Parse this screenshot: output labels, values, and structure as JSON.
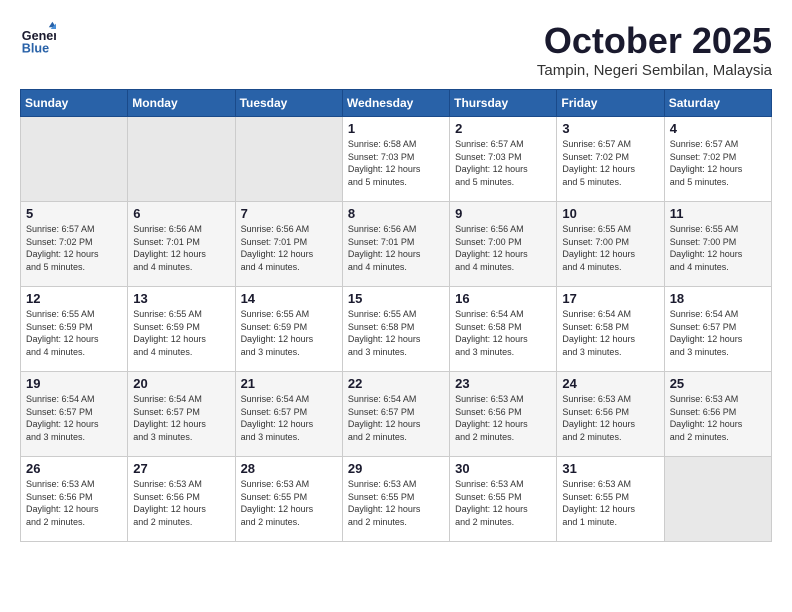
{
  "header": {
    "logo_line1": "General",
    "logo_line2": "Blue",
    "month_title": "October 2025",
    "subtitle": "Tampin, Negeri Sembilan, Malaysia"
  },
  "days_of_week": [
    "Sunday",
    "Monday",
    "Tuesday",
    "Wednesday",
    "Thursday",
    "Friday",
    "Saturday"
  ],
  "weeks": [
    [
      {
        "day": "",
        "info": ""
      },
      {
        "day": "",
        "info": ""
      },
      {
        "day": "",
        "info": ""
      },
      {
        "day": "1",
        "info": "Sunrise: 6:58 AM\nSunset: 7:03 PM\nDaylight: 12 hours\nand 5 minutes."
      },
      {
        "day": "2",
        "info": "Sunrise: 6:57 AM\nSunset: 7:03 PM\nDaylight: 12 hours\nand 5 minutes."
      },
      {
        "day": "3",
        "info": "Sunrise: 6:57 AM\nSunset: 7:02 PM\nDaylight: 12 hours\nand 5 minutes."
      },
      {
        "day": "4",
        "info": "Sunrise: 6:57 AM\nSunset: 7:02 PM\nDaylight: 12 hours\nand 5 minutes."
      }
    ],
    [
      {
        "day": "5",
        "info": "Sunrise: 6:57 AM\nSunset: 7:02 PM\nDaylight: 12 hours\nand 5 minutes."
      },
      {
        "day": "6",
        "info": "Sunrise: 6:56 AM\nSunset: 7:01 PM\nDaylight: 12 hours\nand 4 minutes."
      },
      {
        "day": "7",
        "info": "Sunrise: 6:56 AM\nSunset: 7:01 PM\nDaylight: 12 hours\nand 4 minutes."
      },
      {
        "day": "8",
        "info": "Sunrise: 6:56 AM\nSunset: 7:01 PM\nDaylight: 12 hours\nand 4 minutes."
      },
      {
        "day": "9",
        "info": "Sunrise: 6:56 AM\nSunset: 7:00 PM\nDaylight: 12 hours\nand 4 minutes."
      },
      {
        "day": "10",
        "info": "Sunrise: 6:55 AM\nSunset: 7:00 PM\nDaylight: 12 hours\nand 4 minutes."
      },
      {
        "day": "11",
        "info": "Sunrise: 6:55 AM\nSunset: 7:00 PM\nDaylight: 12 hours\nand 4 minutes."
      }
    ],
    [
      {
        "day": "12",
        "info": "Sunrise: 6:55 AM\nSunset: 6:59 PM\nDaylight: 12 hours\nand 4 minutes."
      },
      {
        "day": "13",
        "info": "Sunrise: 6:55 AM\nSunset: 6:59 PM\nDaylight: 12 hours\nand 4 minutes."
      },
      {
        "day": "14",
        "info": "Sunrise: 6:55 AM\nSunset: 6:59 PM\nDaylight: 12 hours\nand 3 minutes."
      },
      {
        "day": "15",
        "info": "Sunrise: 6:55 AM\nSunset: 6:58 PM\nDaylight: 12 hours\nand 3 minutes."
      },
      {
        "day": "16",
        "info": "Sunrise: 6:54 AM\nSunset: 6:58 PM\nDaylight: 12 hours\nand 3 minutes."
      },
      {
        "day": "17",
        "info": "Sunrise: 6:54 AM\nSunset: 6:58 PM\nDaylight: 12 hours\nand 3 minutes."
      },
      {
        "day": "18",
        "info": "Sunrise: 6:54 AM\nSunset: 6:57 PM\nDaylight: 12 hours\nand 3 minutes."
      }
    ],
    [
      {
        "day": "19",
        "info": "Sunrise: 6:54 AM\nSunset: 6:57 PM\nDaylight: 12 hours\nand 3 minutes."
      },
      {
        "day": "20",
        "info": "Sunrise: 6:54 AM\nSunset: 6:57 PM\nDaylight: 12 hours\nand 3 minutes."
      },
      {
        "day": "21",
        "info": "Sunrise: 6:54 AM\nSunset: 6:57 PM\nDaylight: 12 hours\nand 3 minutes."
      },
      {
        "day": "22",
        "info": "Sunrise: 6:54 AM\nSunset: 6:57 PM\nDaylight: 12 hours\nand 2 minutes."
      },
      {
        "day": "23",
        "info": "Sunrise: 6:53 AM\nSunset: 6:56 PM\nDaylight: 12 hours\nand 2 minutes."
      },
      {
        "day": "24",
        "info": "Sunrise: 6:53 AM\nSunset: 6:56 PM\nDaylight: 12 hours\nand 2 minutes."
      },
      {
        "day": "25",
        "info": "Sunrise: 6:53 AM\nSunset: 6:56 PM\nDaylight: 12 hours\nand 2 minutes."
      }
    ],
    [
      {
        "day": "26",
        "info": "Sunrise: 6:53 AM\nSunset: 6:56 PM\nDaylight: 12 hours\nand 2 minutes."
      },
      {
        "day": "27",
        "info": "Sunrise: 6:53 AM\nSunset: 6:56 PM\nDaylight: 12 hours\nand 2 minutes."
      },
      {
        "day": "28",
        "info": "Sunrise: 6:53 AM\nSunset: 6:55 PM\nDaylight: 12 hours\nand 2 minutes."
      },
      {
        "day": "29",
        "info": "Sunrise: 6:53 AM\nSunset: 6:55 PM\nDaylight: 12 hours\nand 2 minutes."
      },
      {
        "day": "30",
        "info": "Sunrise: 6:53 AM\nSunset: 6:55 PM\nDaylight: 12 hours\nand 2 minutes."
      },
      {
        "day": "31",
        "info": "Sunrise: 6:53 AM\nSunset: 6:55 PM\nDaylight: 12 hours\nand 1 minute."
      },
      {
        "day": "",
        "info": ""
      }
    ]
  ]
}
